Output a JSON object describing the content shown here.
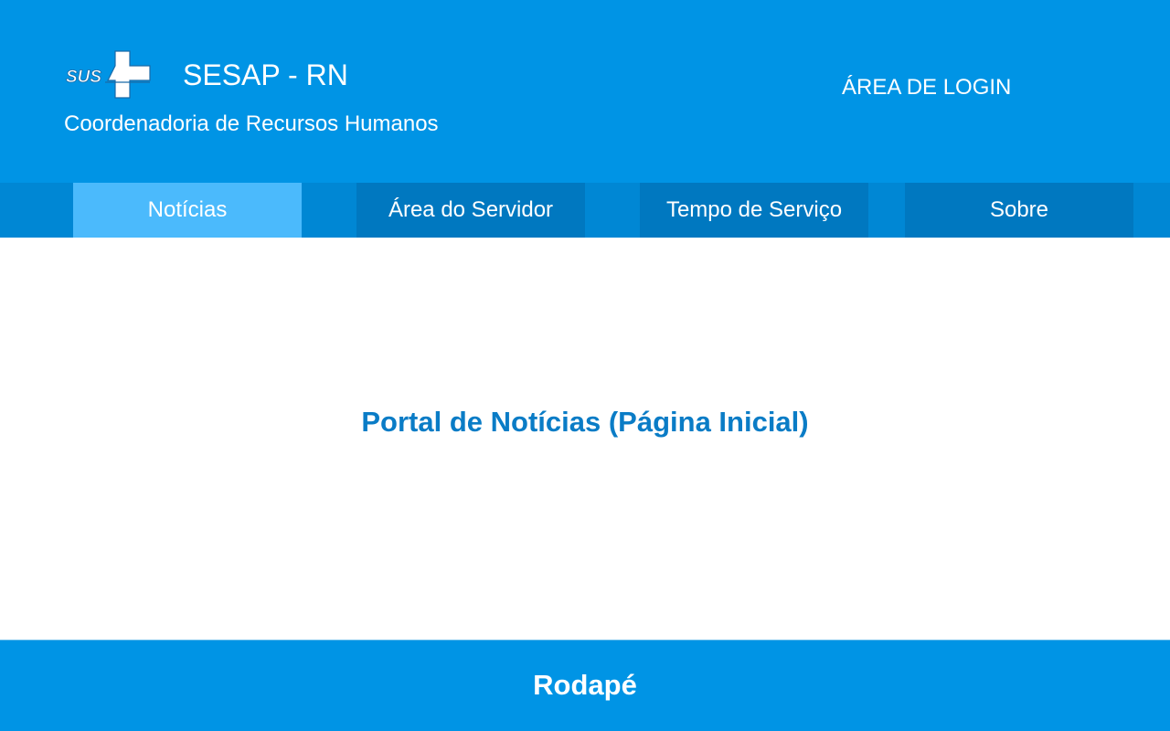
{
  "header": {
    "logo_text": "SUS",
    "title": "SESAP - RN",
    "subtitle": "Coordenadoria de Recursos Humanos",
    "login_label": "ÁREA DE LOGIN"
  },
  "nav": {
    "items": [
      {
        "label": "Notícias",
        "active": true
      },
      {
        "label": "Área do Servidor",
        "active": false
      },
      {
        "label": "Tempo de Serviço",
        "active": false
      },
      {
        "label": "Sobre",
        "active": false
      }
    ]
  },
  "main": {
    "title": "Portal de Notícias (Página Inicial)"
  },
  "footer": {
    "text": "Rodapé"
  },
  "colors": {
    "header_bg": "#0094e5",
    "nav_bg": "#0087d4",
    "nav_item_bg": "#0078c0",
    "nav_active_bg": "#4bbafc",
    "main_title": "#0a7cc6"
  }
}
